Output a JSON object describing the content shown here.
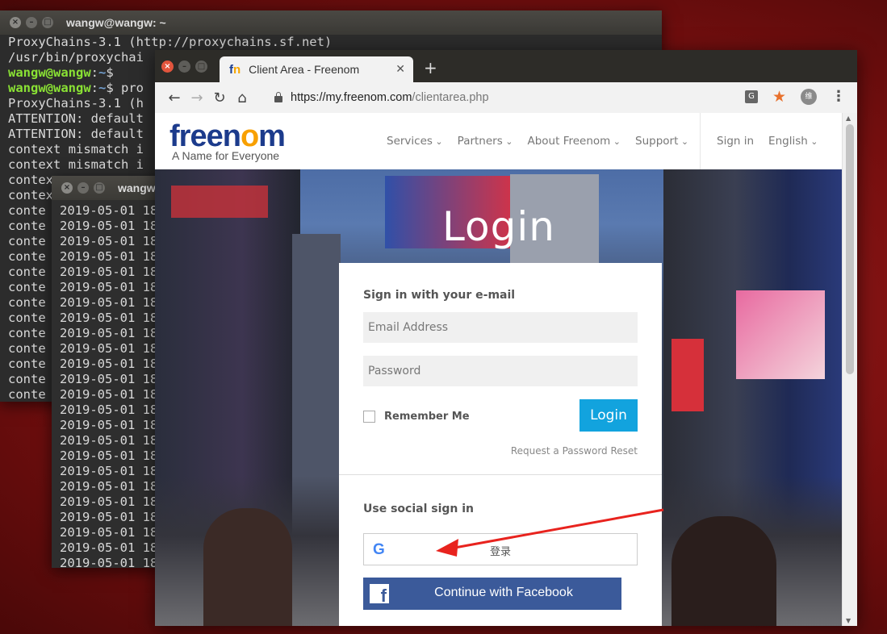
{
  "terminal_back": {
    "title": "wangw@wangw: ~",
    "lines_plain_top": [
      "ProxyChains-3.1 (http://proxychains.sf.net)",
      "/usr/bin/proxychai"
    ],
    "prompt_user": "wangw@wangw",
    "prompt_sep": ":",
    "prompt_path": "~",
    "prompt_cmd1": "$",
    "prompt_cmd2": "$ pro",
    "lines_plain_bottom": [
      "ProxyChains-3.1 (h",
      "ATTENTION: default",
      "ATTENTION: default",
      "context mismatch i",
      "context mismatch i",
      "contex",
      "contex",
      "conte",
      "conte",
      "conte",
      "conte",
      "conte",
      "conte",
      "conte",
      "conte",
      "conte",
      "conte",
      "conte",
      "conte",
      "conte"
    ]
  },
  "terminal_front": {
    "title": "wangw@",
    "line": "2019-05-01 18"
  },
  "browser": {
    "tab_title": "Client Area - Freenom",
    "tab_favicon": "fn",
    "url_host": "https://my.freenom.com",
    "url_path": "/clientarea.php",
    "avatar_text": "维",
    "translate_icon_text": "G"
  },
  "site": {
    "logo": "freenom",
    "tagline": "A Name for Everyone",
    "nav": [
      "Services",
      "Partners",
      "About Freenom",
      "Support"
    ],
    "sign_in": "Sign in",
    "language": "English",
    "hero_title": "Login"
  },
  "login": {
    "heading_email": "Sign in with your e-mail",
    "email_placeholder": "Email Address",
    "password_placeholder": "Password",
    "remember_label": "Remember Me",
    "login_button": "Login",
    "reset_link": "Request a Password Reset",
    "heading_social": "Use social sign in",
    "google_label": "登录",
    "facebook_label": "Continue with Facebook"
  },
  "colors": {
    "login_button": "#12a3de",
    "facebook": "#3b5a9a",
    "annotation_arrow": "#e8231e"
  }
}
